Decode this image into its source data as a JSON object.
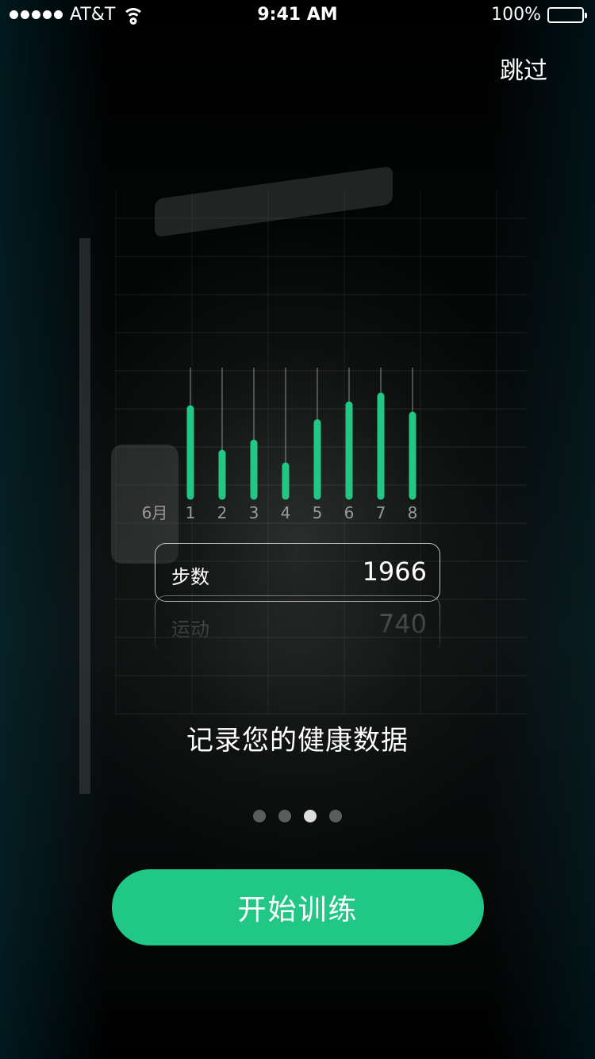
{
  "status_bar": {
    "carrier": "AT&T",
    "time": "9:41 AM",
    "battery_percent": "100%"
  },
  "skip_label": "跳过",
  "chart_data": {
    "type": "bar",
    "month_label": "6月",
    "categories": [
      "1",
      "2",
      "3",
      "4",
      "5",
      "6",
      "7",
      "8"
    ],
    "values": [
      0.7,
      0.35,
      0.43,
      0.25,
      0.59,
      0.73,
      0.8,
      0.65
    ],
    "color": "#21c785"
  },
  "stats": [
    {
      "label": "步数",
      "value": "1966"
    },
    {
      "label": "运动",
      "value": "740"
    }
  ],
  "caption": "记录您的健康数据",
  "pagination": {
    "total": 4,
    "active_index": 2
  },
  "cta_label": "开始训练",
  "colors": {
    "accent": "#21c785",
    "background": "#000000"
  }
}
